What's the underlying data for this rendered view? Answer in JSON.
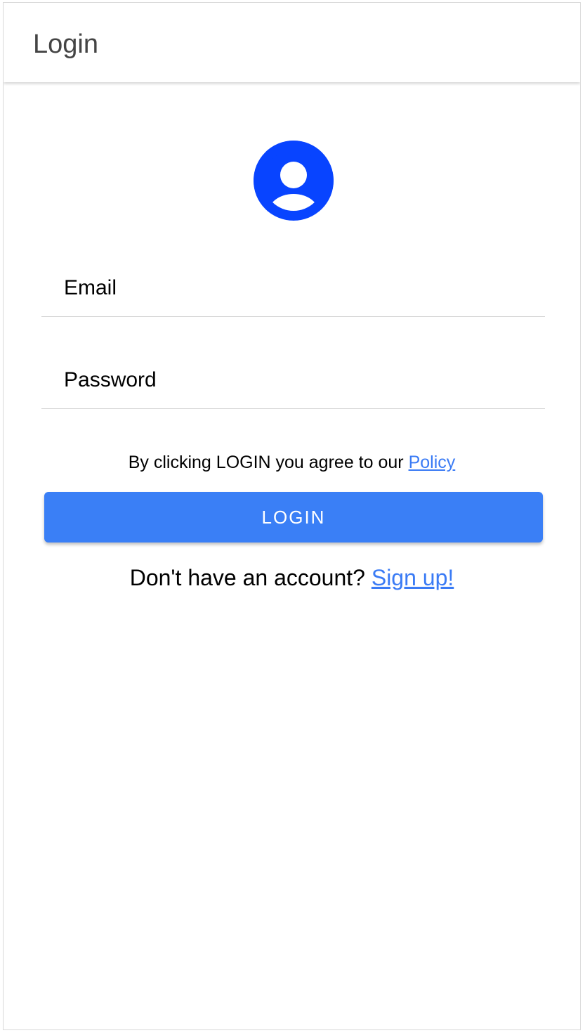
{
  "app_bar": {
    "title": "Login"
  },
  "avatar": {
    "icon": "account-circle-icon",
    "color": "#0844ff"
  },
  "form": {
    "email": {
      "placeholder": "Email",
      "value": ""
    },
    "password": {
      "placeholder": "Password",
      "value": ""
    },
    "policy_text": "By clicking LOGIN you agree to our",
    "policy_link": "Policy",
    "login_button": "LOGIN",
    "signup_text": "Don't have an account?",
    "signup_link": "Sign up!"
  },
  "colors": {
    "accent": "#3a7ff6",
    "link": "#3a7bf5",
    "title_text": "#444444"
  }
}
